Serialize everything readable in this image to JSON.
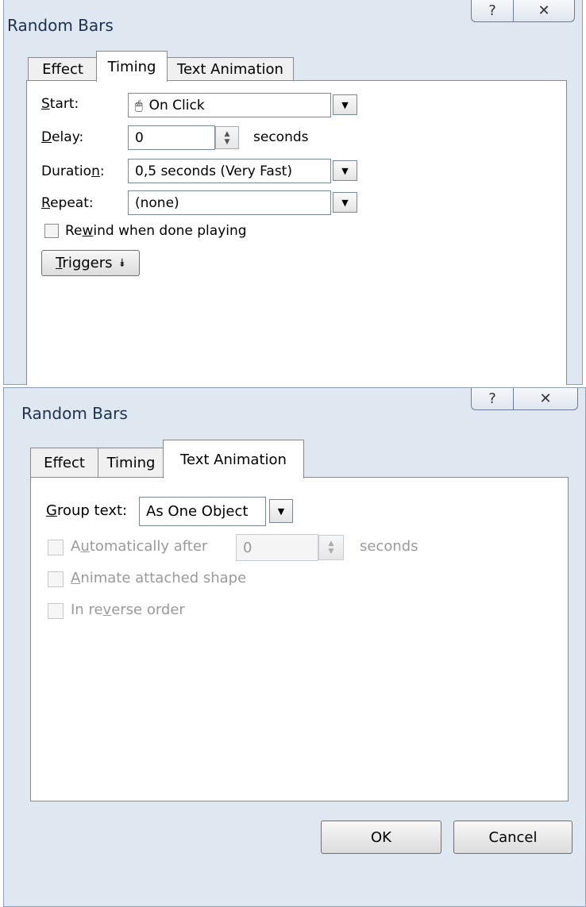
{
  "dialog1": {
    "title": "Random Bars",
    "help_icon": "help-icon",
    "close_icon": "close-icon",
    "tabs": [
      "Effect",
      "Timing",
      "Text Animation"
    ],
    "active_tab": "Timing",
    "start": {
      "label": "Start:",
      "value": "On Click",
      "icon": "mouse-icon"
    },
    "delay": {
      "label": "Delay:",
      "value": "0",
      "unit": "seconds"
    },
    "duration": {
      "label": "Duration:",
      "value": "0,5 seconds (Very Fast)"
    },
    "repeat": {
      "label": "Repeat:",
      "value": "(none)"
    },
    "rewind": {
      "label": "Rewind when done playing",
      "checked": false
    },
    "triggers_button": "Triggers"
  },
  "dialog2": {
    "title": "Random Bars",
    "help_icon": "help-icon",
    "close_icon": "close-icon",
    "tabs": [
      "Effect",
      "Timing",
      "Text Animation"
    ],
    "active_tab": "Text Animation",
    "group_text": {
      "label": "Group text:",
      "value": "As One Object"
    },
    "auto_after": {
      "label": "Automatically after",
      "value": "0",
      "unit": "seconds",
      "enabled": false
    },
    "animate_shape": {
      "label": "Animate attached shape",
      "enabled": false
    },
    "reverse": {
      "label": "In reverse order",
      "enabled": false
    },
    "ok_button": "OK",
    "cancel_button": "Cancel"
  }
}
